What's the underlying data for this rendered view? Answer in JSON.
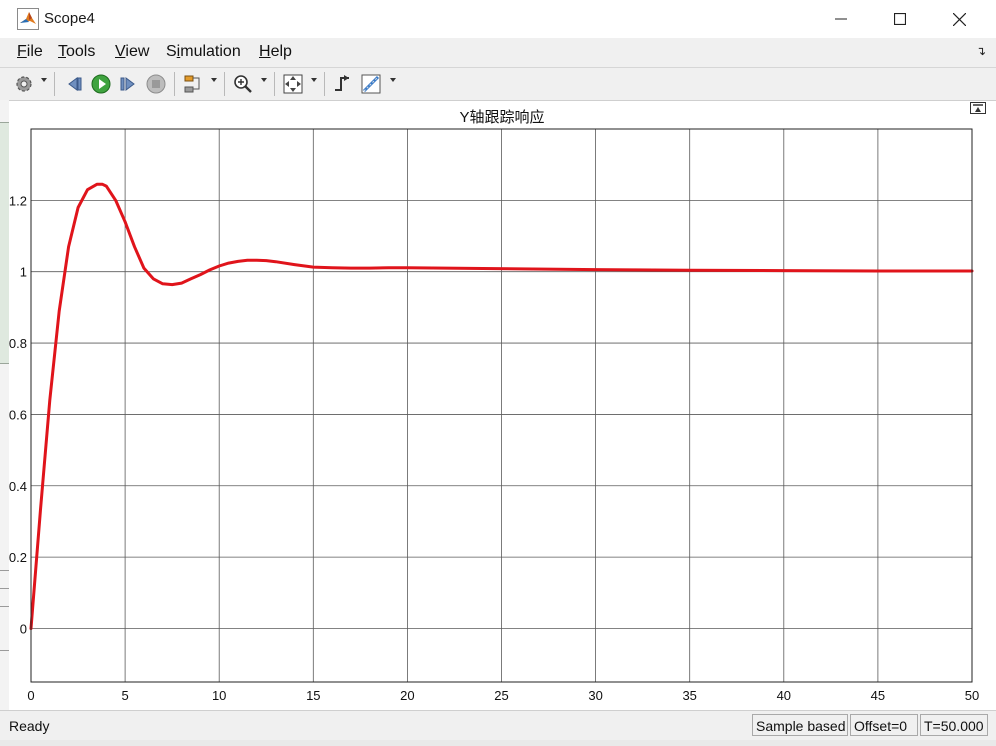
{
  "window": {
    "title": "Scope4"
  },
  "menu": [
    {
      "mnemonic": "F",
      "rest": "ile"
    },
    {
      "mnemonic": "T",
      "rest": "ools"
    },
    {
      "mnemonic": "V",
      "rest": "iew"
    },
    {
      "pre": "S",
      "mnemonic": "i",
      "rest": "mulation"
    },
    {
      "mnemonic": "H",
      "rest": "elp"
    }
  ],
  "toolbar": {
    "icons": [
      "settings-icon",
      "step-back-icon",
      "run-icon",
      "step-forward-icon",
      "stop-icon",
      "signal-highlight-icon",
      "zoom-icon",
      "fit-to-view-icon",
      "triggers-icon",
      "cursor-measurements-icon"
    ]
  },
  "status": {
    "ready": "Ready",
    "mode": "Sample based",
    "offset": "Offset=0",
    "time": "T=50.000"
  },
  "colors": {
    "signal": "#e0141b",
    "grid": "#5a5a5a",
    "axes_bg": "#ffffff"
  },
  "chart_data": {
    "type": "line",
    "title": "Y轴跟踪响应",
    "xlim": [
      0,
      50
    ],
    "ylim": [
      -0.15,
      1.4
    ],
    "xticks": [
      0,
      5,
      10,
      15,
      20,
      25,
      30,
      35,
      40,
      45,
      50
    ],
    "yticks": [
      0,
      0.2,
      0.4,
      0.6,
      0.8,
      1,
      1.2
    ],
    "ytick_labels": [
      "0",
      "0.2",
      "0.4",
      "0.6",
      "0.8",
      "1",
      "1.2"
    ],
    "grid": true,
    "series": [
      {
        "x": [
          0,
          0.5,
          1,
          1.5,
          2,
          2.5,
          3,
          3.5,
          3.8,
          4,
          4.5,
          5,
          5.5,
          6,
          6.5,
          7,
          7.5,
          8,
          8.5,
          9,
          9.5,
          10,
          10.5,
          11,
          11.5,
          12,
          12.5,
          13,
          14,
          15,
          16,
          17,
          18,
          19,
          20,
          22,
          24,
          26,
          28,
          30,
          32,
          35,
          40,
          45,
          50
        ],
        "y": [
          0,
          0.33,
          0.64,
          0.89,
          1.07,
          1.18,
          1.23,
          1.245,
          1.245,
          1.24,
          1.2,
          1.14,
          1.07,
          1.01,
          0.98,
          0.966,
          0.964,
          0.968,
          0.98,
          0.992,
          1.005,
          1.016,
          1.024,
          1.029,
          1.032,
          1.032,
          1.031,
          1.028,
          1.02,
          1.013,
          1.011,
          1.01,
          1.01,
          1.011,
          1.011,
          1.01,
          1.009,
          1.008,
          1.007,
          1.006,
          1.005,
          1.004,
          1.003,
          1.002,
          1.002
        ]
      }
    ]
  }
}
